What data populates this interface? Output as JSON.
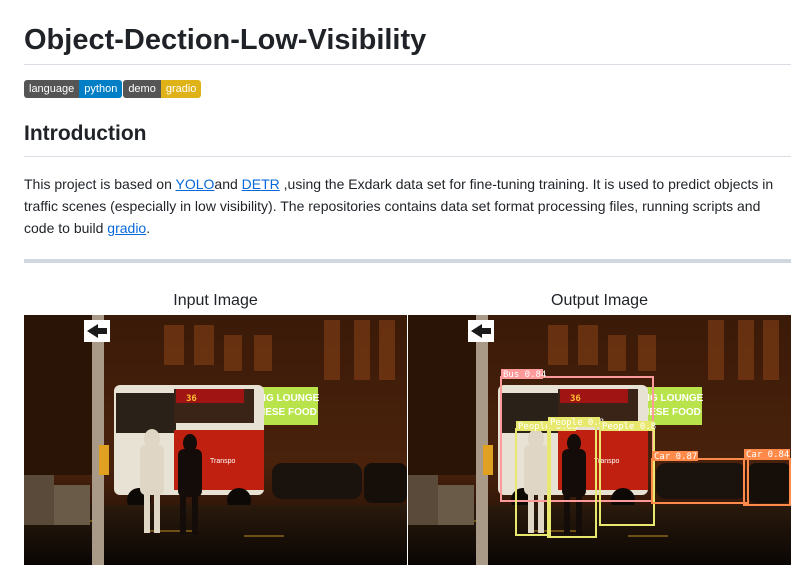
{
  "title": "Object-Dection-Low-Visibility",
  "badges": [
    {
      "key": "language",
      "value": "python",
      "color": "#007ec6"
    },
    {
      "key": "demo",
      "value": "gradio",
      "color": "#dfb317"
    }
  ],
  "introduction": {
    "heading": "Introduction",
    "text_1": "This project is based on ",
    "link_yolo": "YOLO",
    "text_2": "and ",
    "link_detr": "DETR",
    "text_3": " ,using the Exdark data set for fine-tuning training. It is used to predict objects in traffic scenes (especially in low visibility). The repositories contains data set format processing files, running scripts and code to build ",
    "link_gradio": "gradio",
    "text_4": "."
  },
  "images": {
    "input_label": "Input Image",
    "output_label": "Output Image"
  },
  "scene": {
    "bus_route": "36",
    "sign_line1": "ING LOUNGE",
    "sign_line2": "NESE FOOD",
    "operator": "Transpo"
  },
  "detections": [
    {
      "label": "Bus 0.84",
      "color": "#ff9a9a"
    },
    {
      "label": "People 0.88",
      "color": "#e8e86e"
    },
    {
      "label": "People 0.8",
      "color": "#e8e86e"
    },
    {
      "label": "People 0.8",
      "color": "#e8e86e"
    },
    {
      "label": "Car 0.87",
      "color": "#ff8a4a"
    },
    {
      "label": "Car 0.84",
      "color": "#ff8a4a"
    }
  ]
}
